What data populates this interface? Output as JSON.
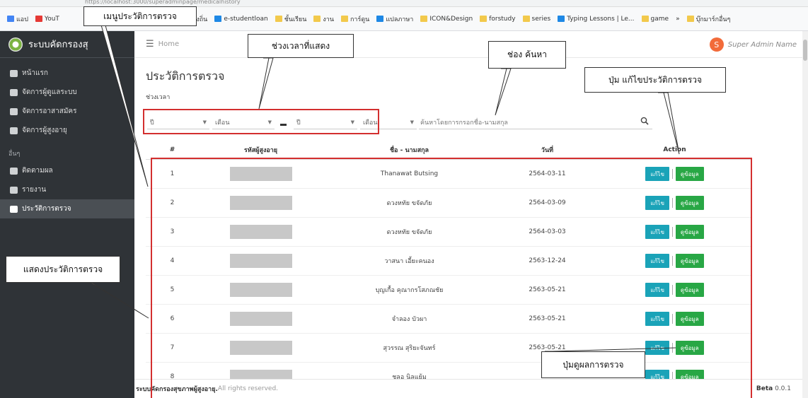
{
  "browser": {
    "url": "https://localhost:3000/superadminpage/medicalhistory",
    "bookmarks": [
      "แอป",
      "YouT",
      "รสแพทองถิ่น",
      "e-studentloan",
      "ชั้นเรียน",
      "งาน",
      "การ์ดูน",
      "แปลภาษา",
      "ICON&Design",
      "forstudy",
      "series",
      "Typing Lessons | Le...",
      "game",
      "»",
      "บุ๊กมาร์กอื่นๆ"
    ]
  },
  "sidebar": {
    "brand": "ระบบคัดกรองสุ",
    "items": [
      {
        "label": "หน้าแรก",
        "icon": "home-icon"
      },
      {
        "label": "จัดการผู้ดูแลระบบ",
        "icon": "users-cog-icon"
      },
      {
        "label": "จัดการอาสาสมัคร",
        "icon": "user-icon"
      },
      {
        "label": "จัดการผู้สูงอายุ",
        "icon": "users-icon"
      }
    ],
    "section": "อื่นๆ",
    "other_items": [
      {
        "label": "ติดตามผล",
        "icon": "calendar-icon"
      },
      {
        "label": "รายงาน",
        "icon": "file-icon"
      },
      {
        "label": "ประวัติการตรวจ",
        "icon": "book-icon",
        "active": true
      }
    ]
  },
  "topbar": {
    "breadcrumb": "Home",
    "avatar_letter": "S",
    "user_name": "Super Admin Name"
  },
  "page": {
    "title": "ประวัติการตรวจ",
    "range_label": "ช่วงเวลา",
    "filters": [
      {
        "placeholder": "ปี"
      },
      {
        "placeholder": "เดือน"
      },
      {
        "placeholder": "ปี"
      },
      {
        "placeholder": "เดือน"
      }
    ],
    "search_placeholder": "ค้นหาโดยการกรอกชื่อ-นามสกุล"
  },
  "table": {
    "headers": [
      "#",
      "รหัสผู้สูงอายุ",
      "ชื่อ - นามสกุล",
      "วันที่",
      "Action"
    ],
    "edit_label": "แก้ไข",
    "view_label": "ดูข้อมูล",
    "rows": [
      {
        "no": "1",
        "name": "Thanawat Butsing",
        "date": "2564-03-11"
      },
      {
        "no": "2",
        "name": "ดวงหทัย ขจัดภัย",
        "date": "2564-03-09"
      },
      {
        "no": "3",
        "name": "ดวงหทัย ขจัดภัย",
        "date": "2564-03-03"
      },
      {
        "no": "4",
        "name": "วาสนา เอี้ยะคนอง",
        "date": "2563-12-24"
      },
      {
        "no": "5",
        "name": "บุญเกื้อ คุณากรโสภณชัย",
        "date": "2563-05-21"
      },
      {
        "no": "6",
        "name": "จำลอง บัวผา",
        "date": "2563-05-21"
      },
      {
        "no": "7",
        "name": "สุวรรณ สุริยะจันทร์",
        "date": "2563-05-21"
      },
      {
        "no": "8",
        "name": "ชลอ นิลแย้ม",
        "date": ""
      }
    ]
  },
  "footer": {
    "brand": "ระบบคัดกรองสุขภาพผู้สูงอายุ.",
    "rights": "All rights reserved.",
    "version_label": "Beta",
    "version": "0.0.1"
  },
  "annotations": {
    "menu": "เมนูประวัติการตรวจ",
    "range": "ช่วงเวลาที่แสดง",
    "search": "ช่อง ค้นหา",
    "edit": "ปุ่ม แก้ไขประวัติการตรวจ",
    "history": "แสดงประวัติการตรวจ",
    "view": "ปุ่มดูผลการตรวจ"
  },
  "colors": {
    "annotation": "#d32f2f",
    "edit_button": "#1aa3b8",
    "view_button": "#28a745",
    "sidebar": "#2f3337"
  }
}
